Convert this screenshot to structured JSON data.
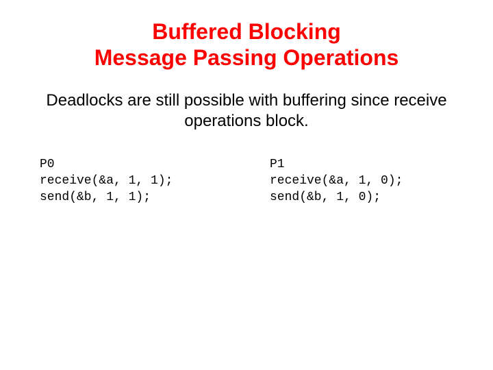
{
  "title_line1": "Buffered Blocking",
  "title_line2": "Message Passing Operations",
  "subtitle": "Deadlocks are still possible with buffering since receive operations block.",
  "code_left": {
    "header": "P0",
    "line1": "receive(&a, 1, 1);",
    "line2": "send(&b, 1, 1);"
  },
  "code_right": {
    "header": "P1",
    "line1": "receive(&a, 1, 0);",
    "line2": "send(&b, 1, 0);"
  }
}
